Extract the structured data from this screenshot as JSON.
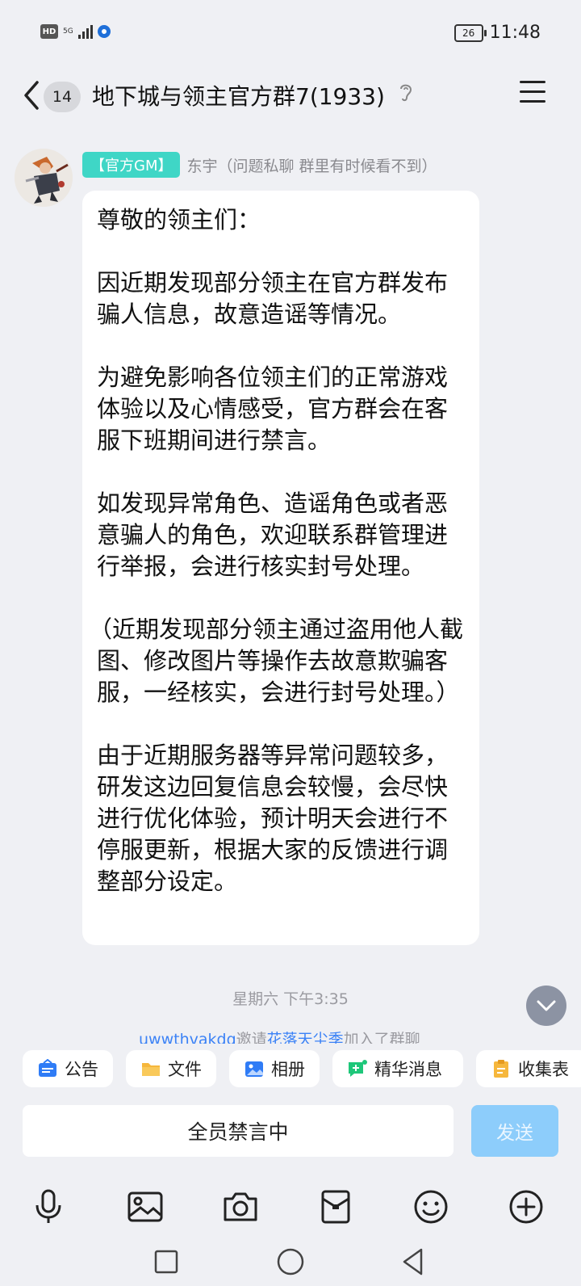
{
  "status_bar": {
    "hd": "HD",
    "network": "5G",
    "battery": "26",
    "time": "11:48"
  },
  "header": {
    "unread_count": "14",
    "title": "地下城与领主官方群7(1933)"
  },
  "message": {
    "badge": "【官方GM】",
    "sender": "东宇（问题私聊 群里有时候看不到）",
    "paragraphs": [
      "尊敬的领主们：",
      "因近期发现部分领主在官方群发布骗人信息，故意造谣等情况。",
      "为避免影响各位领主们的正常游戏体验以及心情感受，官方群会在客服下班期间进行禁言。",
      "如发现异常角色、造谣角色或者恶意骗人的角色，欢迎联系群管理进行举报，会进行核实封号处理。",
      "（近期发现部分领主通过盗用他人截图、修改图片等操作去故意欺骗客服，一经核实，会进行封号处理。）",
      "由于近期服务器等异常问题较多，研发这边回复信息会较慢，会尽快进行优化体验，预计明天会进行不停服更新，根据大家的反馈进行调整部分设定。"
    ]
  },
  "timestamp": "星期六 下午3:35",
  "notice": {
    "inviter": "uwwthvakdq",
    "verb": "邀请",
    "invitee": "花落天尘季",
    "suffix": "加入了群聊"
  },
  "quick_bar": [
    {
      "label": "公告",
      "icon": "announcement-icon",
      "color": "#2f7cf6"
    },
    {
      "label": "文件",
      "icon": "folder-icon",
      "color": "#f6b73c"
    },
    {
      "label": "相册",
      "icon": "album-icon",
      "color": "#2f7cf6"
    },
    {
      "label": "精华消息",
      "icon": "essence-icon",
      "color": "#1ec77a"
    },
    {
      "label": "收集表",
      "icon": "form-icon",
      "color": "#f6b73c"
    }
  ],
  "input": {
    "placeholder": "全员禁言中",
    "send_label": "发送"
  },
  "toolbar_icons": [
    "microphone-icon",
    "image-icon",
    "camera-icon",
    "red-packet-icon",
    "emoji-icon",
    "plus-icon"
  ],
  "nav_icons": [
    "recent-apps-icon",
    "home-icon",
    "back-nav-icon"
  ]
}
